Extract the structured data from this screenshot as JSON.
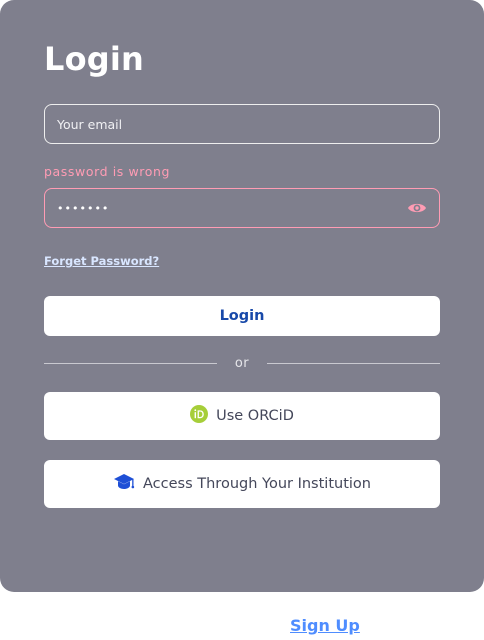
{
  "login_card": {
    "title": "Login",
    "email": {
      "placeholder": "Your email",
      "value": ""
    },
    "error_message": "password is wrong",
    "password": {
      "value": "•••••••"
    },
    "forgot_password_label": "Forget Password?",
    "login_button_label": "Login",
    "divider_label": "or",
    "orcid_button_label": "Use ORCiD",
    "institution_button_label": "Access Through Your Institution"
  },
  "footer": {
    "signup_label": "Sign Up"
  },
  "colors": {
    "card_background": "#7f7f8d",
    "error": "#ff9cb4",
    "login_text": "#1849a9",
    "orcid_green": "#a6ce39",
    "institution_icon": "#1e4fd6",
    "signup_link": "#4f8dff"
  },
  "icons": {
    "password_toggle": "eye-icon",
    "orcid": "orcid-icon",
    "institution": "graduation-cap-icon"
  }
}
